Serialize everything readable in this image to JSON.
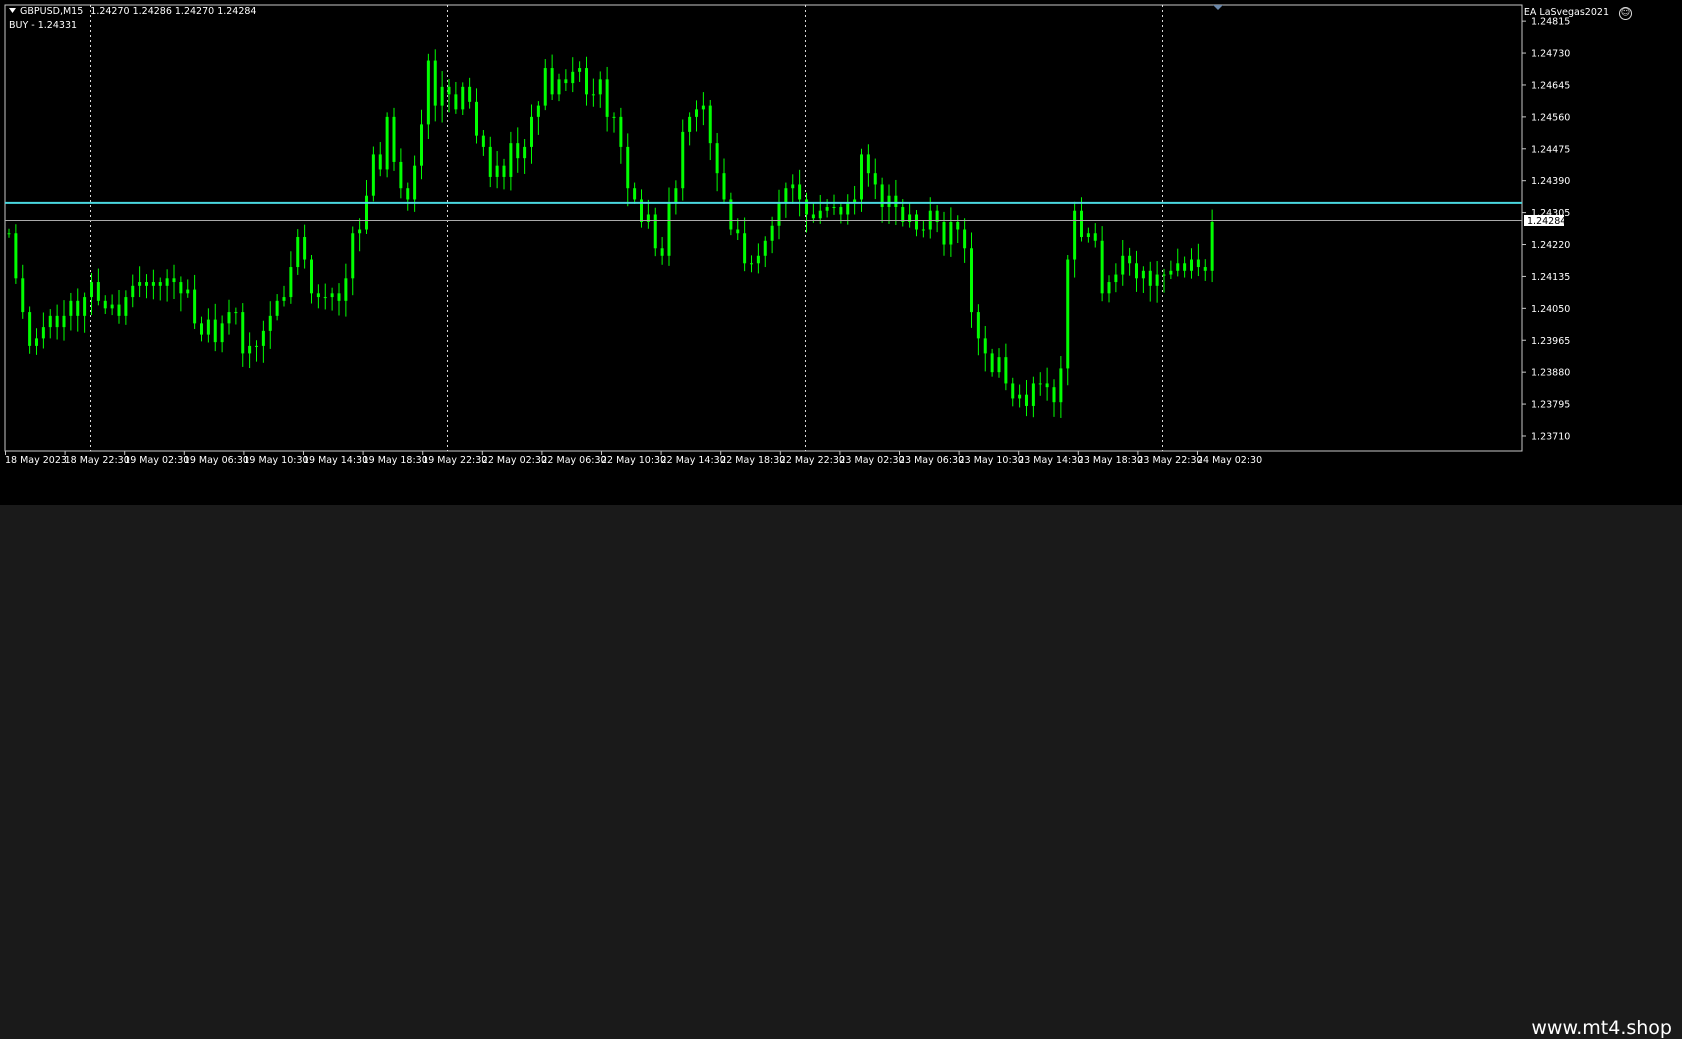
{
  "header": {
    "symbol_timeframe": "GBPUSD,M15",
    "ohlc": "1.24270 1.24286 1.24270 1.24284",
    "signal": "BUY - 1.24331",
    "ea_label": "EA LaSvegas2021",
    "menu_icon": "triangle-down-icon",
    "ea_icon": "smiley-icon"
  },
  "footer": {
    "watermark": "www.mt4.shop"
  },
  "colors": {
    "background": "#000000",
    "candle": "#00ff00",
    "signal_line": "#4ad8e0",
    "bid_line": "#aaaaaa",
    "grid": "#ffffff",
    "text": "#ffffff"
  },
  "chart_data": {
    "type": "candlestick",
    "title": "GBPUSD,M15",
    "xlabel": "",
    "ylabel": "",
    "ylim": [
      1.2367,
      1.24858
    ],
    "y_ticks": [
      "1.24815",
      "1.24730",
      "1.24645",
      "1.24560",
      "1.24475",
      "1.24390",
      "1.24305",
      "1.24220",
      "1.24135",
      "1.24050",
      "1.23965",
      "1.23880",
      "1.23795",
      "1.23710"
    ],
    "x_ticks": [
      "18 May 2023",
      "18 May 22:30",
      "19 May 02:30",
      "19 May 06:30",
      "19 May 10:30",
      "19 May 14:30",
      "19 May 18:30",
      "19 May 22:30",
      "22 May 02:30",
      "22 May 06:30",
      "22 May 10:30",
      "22 May 14:30",
      "22 May 18:30",
      "22 May 22:30",
      "23 May 02:30",
      "23 May 06:30",
      "23 May 10:30",
      "23 May 14:30",
      "23 May 18:30",
      "23 May 22:30",
      "24 May 02:30"
    ],
    "session_separators": [
      "18 May 22:30",
      "19 May 22:30",
      "22 May 22:30",
      "23 May 22:30"
    ],
    "horizontal_levels": [
      {
        "value": 1.24331,
        "label": "BUY - 1.24331"
      },
      {
        "value": 1.24284,
        "label": "1.24284"
      }
    ],
    "current_price": "1.24284",
    "grid": false,
    "series": [
      {
        "closes": [
          1.2425,
          1.2413,
          1.2404,
          1.2395,
          1.2397,
          1.24,
          1.2403,
          1.24,
          1.2403,
          1.2407,
          1.2403,
          1.2408,
          1.2412,
          1.2407,
          1.2405,
          1.2406,
          1.2403,
          1.2408,
          1.2411,
          1.2412,
          1.2411,
          1.2412,
          1.2411,
          1.2413,
          1.2412,
          1.2409,
          1.241,
          1.2401,
          1.2398,
          1.2402,
          1.2396,
          1.2401,
          1.2404,
          1.2404,
          1.2393,
          1.2395,
          1.2395,
          1.2399,
          1.2403,
          1.2407,
          1.2408,
          1.2416,
          1.2424,
          1.2418,
          1.2409,
          1.2408,
          1.2408,
          1.2409,
          1.2407,
          1.2413,
          1.2425,
          1.2426,
          1.2435,
          1.2446,
          1.2442,
          1.2456,
          1.2444,
          1.2437,
          1.2434,
          1.2443,
          1.2454,
          1.2471,
          1.2459,
          1.2464,
          1.2462,
          1.2458,
          1.2464,
          1.246,
          1.2451,
          1.2448,
          1.244,
          1.2443,
          1.244,
          1.2449,
          1.2445,
          1.2448,
          1.2456,
          1.2459,
          1.2469,
          1.2462,
          1.2466,
          1.2465,
          1.2468,
          1.2469,
          1.2462,
          1.2462,
          1.2466,
          1.2456,
          1.2456,
          1.2448,
          1.2437,
          1.2434,
          1.2428,
          1.243,
          1.2421,
          1.2419,
          1.2433,
          1.2437,
          1.2452,
          1.2456,
          1.2458,
          1.2459,
          1.2449,
          1.2441,
          1.2434,
          1.2426,
          1.2425,
          1.2417,
          1.2417,
          1.2419,
          1.2423,
          1.2427,
          1.2433,
          1.2437,
          1.2438,
          1.2434,
          1.243,
          1.2429,
          1.2431,
          1.2432,
          1.2432,
          1.243,
          1.2433,
          1.2434,
          1.2446,
          1.2441,
          1.2438,
          1.2432,
          1.2435,
          1.2432,
          1.2428,
          1.243,
          1.2426,
          1.2426,
          1.2431,
          1.2428,
          1.2422,
          1.2428,
          1.2426,
          1.2421,
          1.2404,
          1.2397,
          1.2393,
          1.2388,
          1.2392,
          1.2385,
          1.2381,
          1.2382,
          1.2379,
          1.2385,
          1.2385,
          1.2384,
          1.238,
          1.2389,
          1.2418,
          1.2431,
          1.2424,
          1.2425,
          1.2423,
          1.2409,
          1.2412,
          1.2414,
          1.2419,
          1.2417,
          1.2413,
          1.2415,
          1.2411,
          1.2414,
          1.2414,
          1.2415,
          1.2417,
          1.2415,
          1.2418,
          1.2416,
          1.2415,
          1.2428
        ]
      }
    ]
  }
}
